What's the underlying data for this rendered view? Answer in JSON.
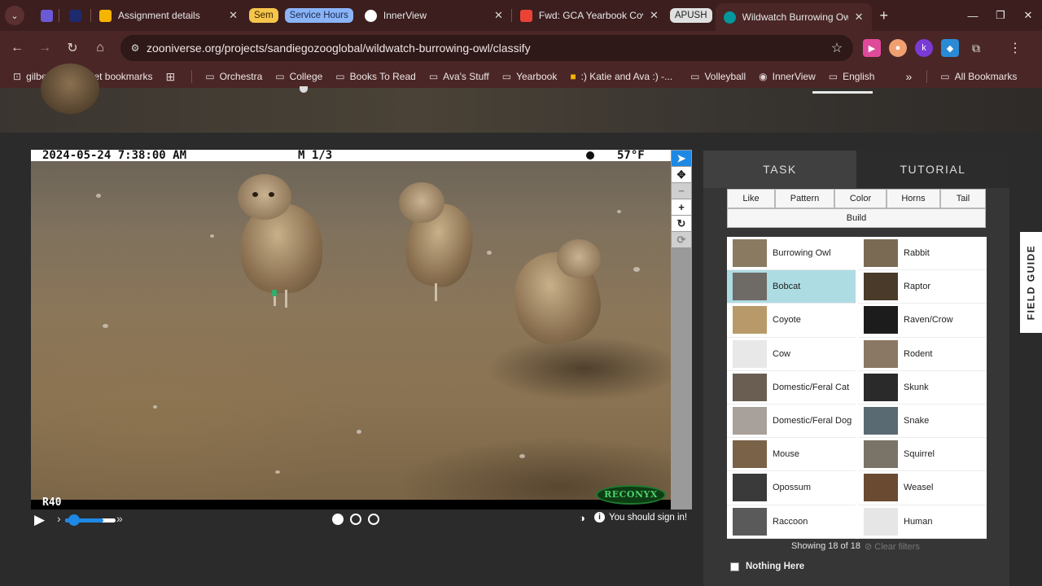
{
  "browser": {
    "tabs": [
      {
        "title": "Assignment details",
        "close": "✕"
      },
      {
        "title": "InnerView",
        "close": "✕"
      },
      {
        "title": "Fwd: GCA Yearbook Cove",
        "close": "✕"
      },
      {
        "title": "Wildwatch Burrowing Owl",
        "close": "✕"
      }
    ],
    "groups": [
      "Sem",
      "Service Hours",
      "APUSH"
    ],
    "new_tab": "+",
    "url": "zooniverse.org/projects/sandiegozooglobal/wildwatch-burrowing-owl/classify",
    "bookmarks": [
      "gilbertschools.net bookmarks",
      "Orchestra",
      "College",
      "Books To Read",
      "Ava's Stuff",
      "Yearbook",
      ":) Katie and Ava :) -...",
      "Volleyball",
      "InnerView",
      "English"
    ],
    "all_bookmarks": "All Bookmarks",
    "more_bookmarks": "»"
  },
  "viewer": {
    "cam_datetime": "2024-05-24 7:38:00 AM",
    "cam_mode": "M 1/3",
    "cam_temp": "57°F",
    "cam_id": "R40",
    "cam_brand": "RECONYX",
    "tools": [
      "pointer-icon",
      "pan-icon",
      "zoom-out-icon",
      "zoom-in-icon",
      "rotate-icon",
      "reset-icon"
    ],
    "frames": 3,
    "active_frame": 1,
    "playback_speed": 0.75,
    "sign_in_msg": "You should sign in!"
  },
  "task": {
    "tabs": [
      "TASK",
      "TUTORIAL"
    ],
    "filters": [
      "Like",
      "Pattern",
      "Color",
      "Horns",
      "Tail"
    ],
    "build": "Build",
    "choices": [
      {
        "label": "Burrowing Owl",
        "color": "#8a7a62"
      },
      {
        "label": "Rabbit",
        "color": "#7a6a54"
      },
      {
        "label": "Bobcat",
        "color": "#6e6a66",
        "selected": true
      },
      {
        "label": "Raptor",
        "color": "#4a3a2a"
      },
      {
        "label": "Coyote",
        "color": "#b89a6a"
      },
      {
        "label": "Raven/Crow",
        "color": "#1c1c1c"
      },
      {
        "label": "Cow",
        "color": "#e8e8e8"
      },
      {
        "label": "Rodent",
        "color": "#8a7864"
      },
      {
        "label": "Domestic/Feral Cat",
        "color": "#6a5e52"
      },
      {
        "label": "Skunk",
        "color": "#2a2a2a"
      },
      {
        "label": "Domestic/Feral Dog",
        "color": "#a8a09a"
      },
      {
        "label": "Snake",
        "color": "#5a6a72"
      },
      {
        "label": "Mouse",
        "color": "#7a6248"
      },
      {
        "label": "Squirrel",
        "color": "#7a7468"
      },
      {
        "label": "Opossum",
        "color": "#3a3a3a"
      },
      {
        "label": "Weasel",
        "color": "#6a4a30"
      },
      {
        "label": "Raccoon",
        "color": "#5a5a5a"
      },
      {
        "label": "Human",
        "color": "#e6e6e6"
      }
    ],
    "showing": "Showing 18 of 18",
    "clear_filters": "⊘ Clear filters",
    "nothing_here": "Nothing Here",
    "field_guide": "FIELD GUIDE"
  }
}
